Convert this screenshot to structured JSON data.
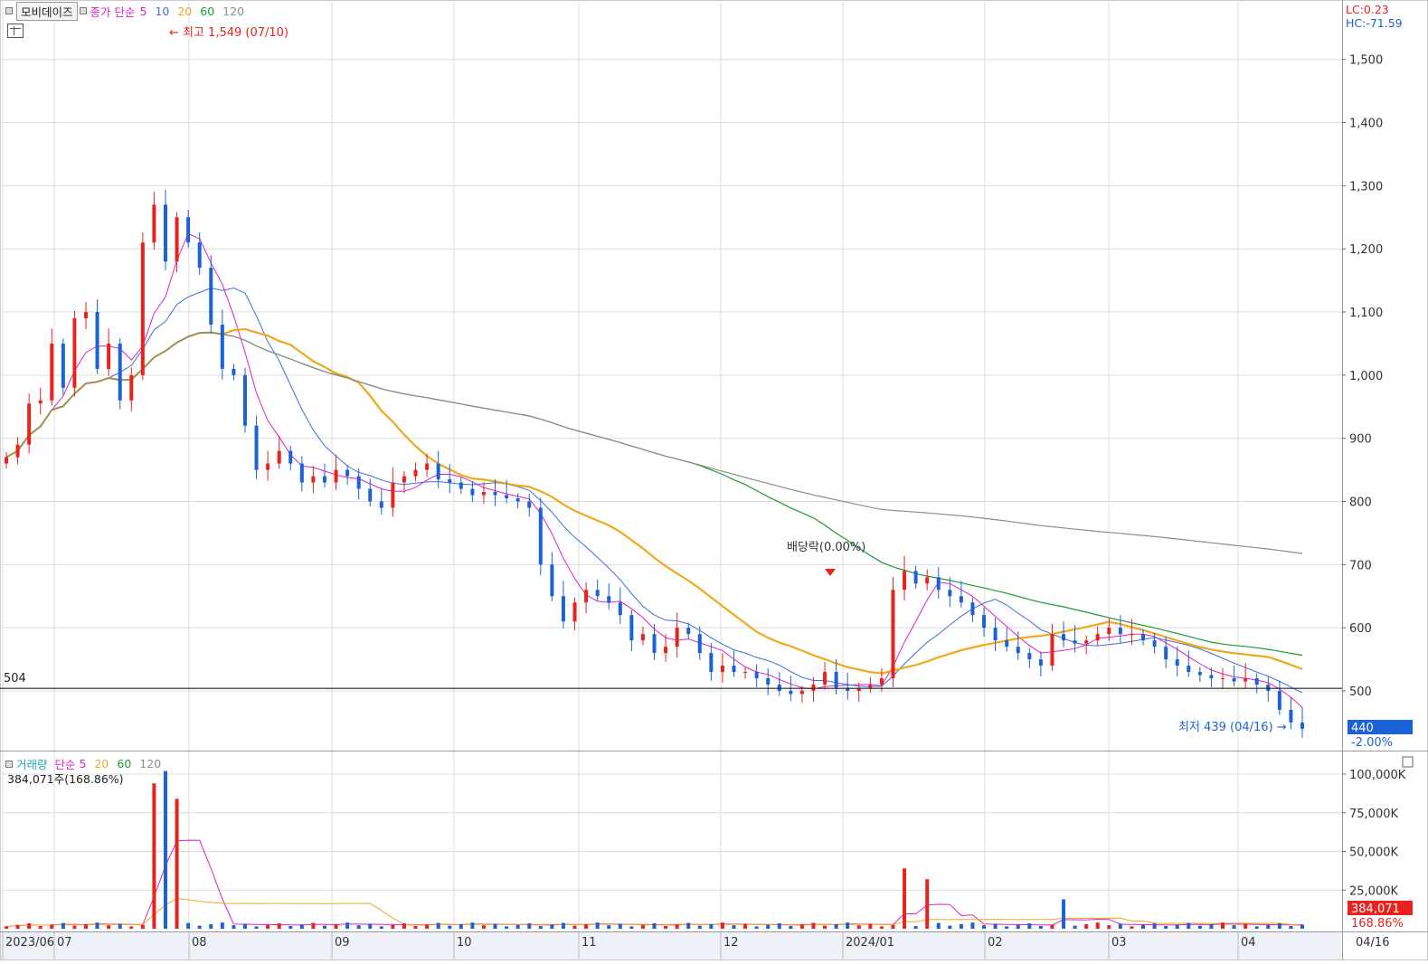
{
  "header": {
    "stock_name": "모비데이즈",
    "price_legend": {
      "label": "종가 단순",
      "periods": [
        "5",
        "10",
        "20",
        "60",
        "120"
      ]
    },
    "lc": "LC:0.23",
    "hc": "HC:-71.59"
  },
  "colors": {
    "up": "#e8231f",
    "down": "#1c62d6",
    "ma5": "#e020c8",
    "ma10": "#3a6fe0",
    "ma20": "#f0a81c",
    "ma60": "#1e9a30",
    "ma120": "#8c8c8c",
    "grid": "#dcdcdc",
    "axis_bg": "#ffffff"
  },
  "annotations": {
    "high": "최고 1,549 (07/10)",
    "low": "최저 439 (04/16)",
    "dividend": "배당락(0.00%)",
    "ref_line_label": "504",
    "current_price": "440",
    "current_change": "-2.00%"
  },
  "volume_panel": {
    "legend_label": "거래량",
    "ma_label": "단순",
    "periods": [
      "5",
      "20",
      "60",
      "120"
    ],
    "current_volume": "384,071주(168.86%)",
    "current_box": "384,071",
    "current_ratio": "168.86%"
  },
  "chart_data": [
    {
      "type": "candlestick",
      "title": "",
      "y_axis_ticks": [
        "500",
        "600",
        "700",
        "800",
        "900",
        "1,000",
        "1,100",
        "1,200",
        "1,300",
        "1,400",
        "1,500"
      ],
      "x_axis_labels": [
        "2023/06",
        "07",
        "08",
        "09",
        "10",
        "11",
        "12",
        "2024/01",
        "02",
        "03",
        "04",
        "04/16"
      ],
      "ylim": [
        430,
        1590
      ],
      "reference_line": 504,
      "summary": {
        "high": 1549,
        "high_date": "07/10",
        "low": 439,
        "low_date": "04/16",
        "last": 440
      },
      "closes_approx": [
        870,
        890,
        955,
        960,
        1050,
        980,
        1090,
        1100,
        1010,
        1050,
        960,
        1000,
        1210,
        1270,
        1180,
        1250,
        1210,
        1170,
        1080,
        1010,
        1000,
        920,
        850,
        860,
        880,
        860,
        830,
        840,
        830,
        850,
        840,
        820,
        800,
        790,
        830,
        840,
        850,
        860,
        835,
        830,
        820,
        810,
        815,
        810,
        805,
        800,
        790,
        700,
        650,
        610,
        640,
        660,
        650,
        640,
        620,
        580,
        590,
        560,
        570,
        600,
        590,
        560,
        530,
        540,
        530,
        530,
        520,
        510,
        500,
        495,
        500,
        510,
        530,
        505,
        500,
        505,
        510,
        520,
        660,
        690,
        670,
        680,
        660,
        650,
        640,
        620,
        600,
        580,
        570,
        560,
        550,
        540,
        590,
        580,
        575,
        580,
        590,
        600,
        590,
        590,
        580,
        570,
        550,
        540,
        530,
        525,
        520,
        520,
        515,
        520,
        510,
        500,
        470,
        450,
        440
      ]
    },
    {
      "type": "bar",
      "title": "",
      "y_axis_ticks": [
        "25,000K",
        "50,000K",
        "75,000K",
        "100,000K"
      ],
      "ylim": [
        0,
        105000
      ],
      "unit": "K shares",
      "peaks": [
        {
          "date": "07/10",
          "value": 102000
        },
        {
          "date": "07/07",
          "value": 94000
        },
        {
          "date": "07/11",
          "value": 84000
        },
        {
          "date": "12/26",
          "value": 39000
        },
        {
          "date": "12/29",
          "value": 32000
        },
        {
          "date": "02/01",
          "value": 19000
        }
      ]
    }
  ]
}
